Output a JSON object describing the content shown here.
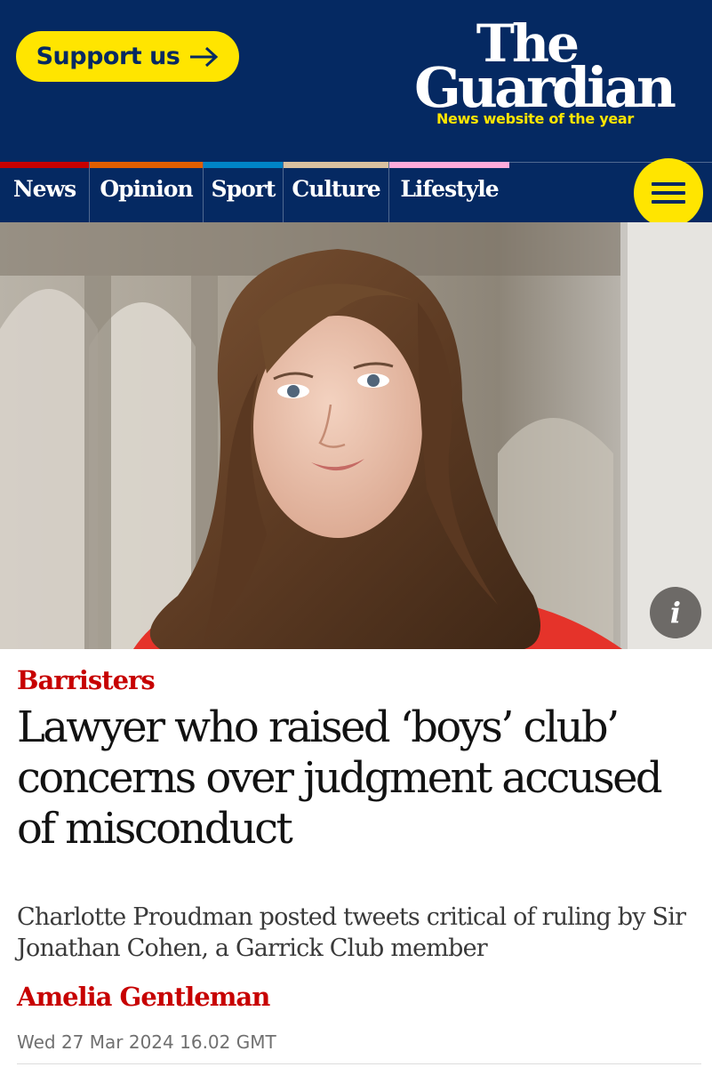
{
  "header": {
    "support_label": "Support us",
    "logo_line1": "The",
    "logo_line2": "Guardian",
    "tagline": "News website of the year"
  },
  "nav": {
    "items": [
      {
        "label": "News",
        "color": "#c70000"
      },
      {
        "label": "Opinion",
        "color": "#e05e00"
      },
      {
        "label": "Sport",
        "color": "#0084c6"
      },
      {
        "label": "Culture",
        "color": "#a1845c"
      },
      {
        "label": "Lifestyle",
        "color": "#bb3b80"
      }
    ],
    "menu_icon": "hamburger-icon"
  },
  "hero": {
    "info_icon": "info-icon",
    "info_glyph": "i"
  },
  "article": {
    "kicker": "Barristers",
    "headline": "Lawyer who raised ‘boys’ club’ concerns over judgment accused of misconduct",
    "standfirst": "Charlotte Proudman posted tweets critical of ruling by Sir Jonathan Cohen, a Garrick Club member",
    "byline": "Amelia Gentleman",
    "dateline": "Wed 27 Mar 2024 16.02 GMT"
  },
  "colors": {
    "brand_blue": "#052962",
    "brand_yellow": "#ffe500",
    "news_red": "#c70000"
  }
}
